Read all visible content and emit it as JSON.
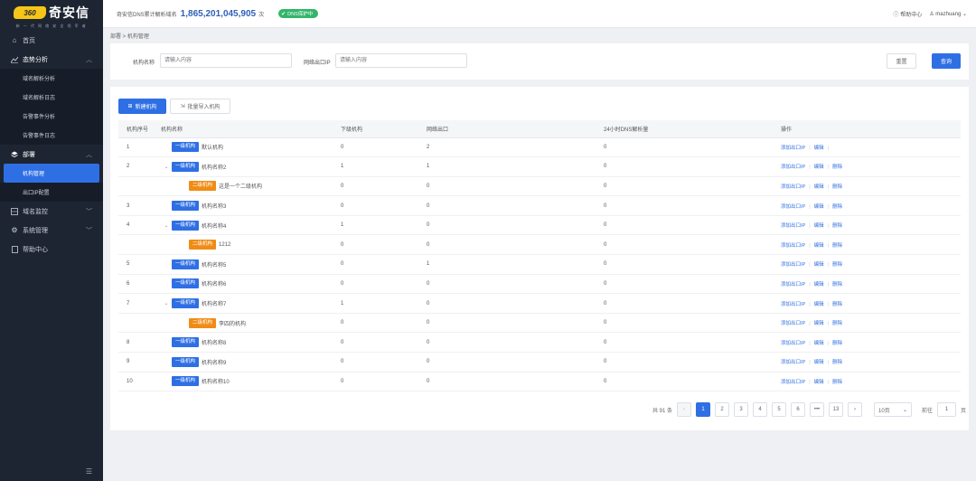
{
  "brand": {
    "logo_mark": "360",
    "name": "奇安信",
    "tagline": "新 一 代 网 络 安 全 领 军 者"
  },
  "sidebar": {
    "items": [
      {
        "label": "首页",
        "icon": "home-icon"
      },
      {
        "label": "态势分析",
        "icon": "chart-icon",
        "expanded": true,
        "children": [
          "域名解析分析",
          "域名解析日志",
          "告警事件分析",
          "告警事件日志"
        ]
      },
      {
        "label": "部署",
        "icon": "deploy-icon",
        "expanded": true,
        "children": [
          "机构管理",
          "出口IP配置"
        ],
        "active_child": "机构管理"
      },
      {
        "label": "域名监控",
        "icon": "globe-icon"
      },
      {
        "label": "系统管理",
        "icon": "gear-icon"
      },
      {
        "label": "帮助中心",
        "icon": "doc-icon"
      }
    ]
  },
  "topbar": {
    "stat_label": "奇安信DNS累计解析域名",
    "stat_value": "1,865,201,045,905",
    "stat_unit": "次",
    "protect_badge": "DNS保护中",
    "help": "帮助中心",
    "user": "mazhuang"
  },
  "breadcrumb": "部署 > 机构管理",
  "filter": {
    "org_label": "机构名称",
    "org_placeholder": "请输入内容",
    "ip_label": "网络出口IP",
    "ip_placeholder": "请输入内容",
    "reset": "重置",
    "search": "查询"
  },
  "toolbar": {
    "new_label": "新建机构",
    "import_label": "批量导入机构"
  },
  "table": {
    "headers": [
      "机构序号",
      "机构名称",
      "下级机构",
      "网络出口",
      "24小时DNS解析量",
      "操作"
    ],
    "rows": [
      {
        "no": "1",
        "level": "一级机构",
        "name": "默认机构",
        "sub": "0",
        "exit": "2",
        "dns": "0",
        "ops": [
          "添加出口IP",
          "编辑"
        ],
        "child": false,
        "expand": false
      },
      {
        "no": "2",
        "level": "一级机构",
        "name": "机构名称2",
        "sub": "1",
        "exit": "1",
        "dns": "0",
        "ops": [
          "添加出口IP",
          "编辑",
          "删除"
        ],
        "child": false,
        "expand": true
      },
      {
        "no": "",
        "level": "二级机构",
        "name": "这是一个二级机构",
        "sub": "0",
        "exit": "0",
        "dns": "0",
        "ops": [
          "添加出口IP",
          "编辑",
          "删除"
        ],
        "child": true
      },
      {
        "no": "3",
        "level": "一级机构",
        "name": "机构名称3",
        "sub": "0",
        "exit": "0",
        "dns": "0",
        "ops": [
          "添加出口IP",
          "编辑",
          "删除"
        ],
        "child": false,
        "expand": false
      },
      {
        "no": "4",
        "level": "一级机构",
        "name": "机构名称4",
        "sub": "1",
        "exit": "0",
        "dns": "0",
        "ops": [
          "添加出口IP",
          "编辑",
          "删除"
        ],
        "child": false,
        "expand": true
      },
      {
        "no": "",
        "level": "二级机构",
        "name": "1212",
        "sub": "0",
        "exit": "0",
        "dns": "0",
        "ops": [
          "添加出口IP",
          "编辑",
          "删除"
        ],
        "child": true
      },
      {
        "no": "5",
        "level": "一级机构",
        "name": "机构名称5",
        "sub": "0",
        "exit": "1",
        "dns": "0",
        "ops": [
          "添加出口IP",
          "编辑",
          "删除"
        ],
        "child": false,
        "expand": false
      },
      {
        "no": "6",
        "level": "一级机构",
        "name": "机构名称6",
        "sub": "0",
        "exit": "0",
        "dns": "0",
        "ops": [
          "添加出口IP",
          "编辑",
          "删除"
        ],
        "child": false,
        "expand": false
      },
      {
        "no": "7",
        "level": "一级机构",
        "name": "机构名称7",
        "sub": "1",
        "exit": "0",
        "dns": "0",
        "ops": [
          "添加出口IP",
          "编辑",
          "删除"
        ],
        "child": false,
        "expand": true
      },
      {
        "no": "",
        "level": "二级机构",
        "name": "李四的机构",
        "sub": "0",
        "exit": "0",
        "dns": "0",
        "ops": [
          "添加出口IP",
          "编辑",
          "删除"
        ],
        "child": true
      },
      {
        "no": "8",
        "level": "一级机构",
        "name": "机构名称8",
        "sub": "0",
        "exit": "0",
        "dns": "0",
        "ops": [
          "添加出口IP",
          "编辑",
          "删除"
        ],
        "child": false,
        "expand": false
      },
      {
        "no": "9",
        "level": "一级机构",
        "name": "机构名称9",
        "sub": "0",
        "exit": "0",
        "dns": "0",
        "ops": [
          "添加出口IP",
          "编辑",
          "删除"
        ],
        "child": false,
        "expand": false
      },
      {
        "no": "10",
        "level": "一级机构",
        "name": "机构名称10",
        "sub": "0",
        "exit": "0",
        "dns": "0",
        "ops": [
          "添加出口IP",
          "编辑",
          "删除"
        ],
        "child": false,
        "expand": false
      }
    ]
  },
  "pagination": {
    "total": "共 91 条",
    "pages": [
      "1",
      "2",
      "3",
      "4",
      "5",
      "6",
      "•••",
      "13"
    ],
    "current": "1",
    "prev": "‹",
    "next": "›",
    "page_size": "10页",
    "goto_label": "前往",
    "goto_value": "1",
    "goto_unit": "页"
  },
  "colors": {
    "primary": "#2f6fe4",
    "orange": "#f08c16",
    "sidebar": "#1e2532",
    "green": "#33b56a"
  }
}
